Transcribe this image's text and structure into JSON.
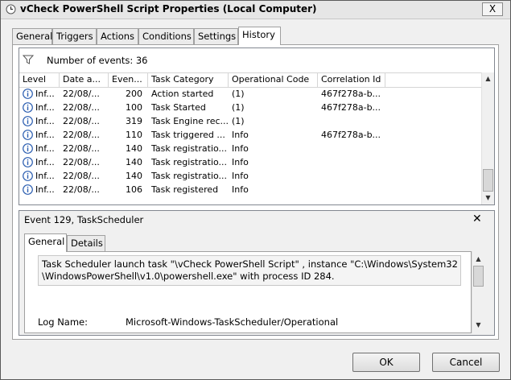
{
  "window": {
    "title": "vCheck PowerShell Script Properties (Local Computer)",
    "close_glyph": "X"
  },
  "tabs": [
    {
      "label": "General"
    },
    {
      "label": "Triggers"
    },
    {
      "label": "Actions"
    },
    {
      "label": "Conditions"
    },
    {
      "label": "Settings"
    },
    {
      "label": "History"
    }
  ],
  "events": {
    "count_text": "Number of events: 36",
    "columns": [
      "Level",
      "Date a...",
      "Even...",
      "Task Category",
      "Operational Code",
      "Correlation Id"
    ],
    "rows": [
      {
        "level": "Inf...",
        "date": "22/08/...",
        "event": "200",
        "category": "Action started",
        "opcode": "(1)",
        "correlation": "467f278a-b..."
      },
      {
        "level": "Inf...",
        "date": "22/08/...",
        "event": "100",
        "category": "Task Started",
        "opcode": "(1)",
        "correlation": "467f278a-b..."
      },
      {
        "level": "Inf...",
        "date": "22/08/...",
        "event": "319",
        "category": "Task Engine rec...",
        "opcode": "(1)",
        "correlation": ""
      },
      {
        "level": "Inf...",
        "date": "22/08/...",
        "event": "110",
        "category": "Task triggered ...",
        "opcode": "Info",
        "correlation": "467f278a-b..."
      },
      {
        "level": "Inf...",
        "date": "22/08/...",
        "event": "140",
        "category": "Task registratio...",
        "opcode": "Info",
        "correlation": ""
      },
      {
        "level": "Inf...",
        "date": "22/08/...",
        "event": "140",
        "category": "Task registratio...",
        "opcode": "Info",
        "correlation": ""
      },
      {
        "level": "Inf...",
        "date": "22/08/...",
        "event": "140",
        "category": "Task registratio...",
        "opcode": "Info",
        "correlation": ""
      },
      {
        "level": "Inf...",
        "date": "22/08/...",
        "event": "106",
        "category": "Task registered",
        "opcode": "Info",
        "correlation": ""
      }
    ]
  },
  "detail": {
    "title": "Event 129, TaskScheduler",
    "close_glyph": "✕",
    "tabs": [
      {
        "label": "General"
      },
      {
        "label": "Details"
      }
    ],
    "message_line1": "Task Scheduler launch task \"\\vCheck PowerShell Script\" , instance \"C:\\Windows\\System32",
    "message_line2": "\\WindowsPowerShell\\v1.0\\powershell.exe\"  with process ID 284.",
    "log_name_label": "Log Name:",
    "log_name_value": "Microsoft-Windows-TaskScheduler/Operational"
  },
  "buttons": {
    "ok": "OK",
    "cancel": "Cancel"
  },
  "colors": {
    "info_icon": "#2a5db0",
    "selection_border": "#a0a0a0"
  }
}
